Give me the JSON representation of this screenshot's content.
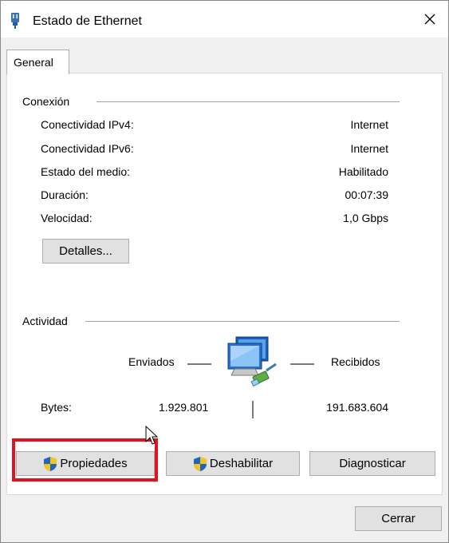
{
  "window": {
    "title": "Estado de Ethernet",
    "close_icon": "close-icon",
    "app_icon": "ethernet-plug-icon"
  },
  "tabs": [
    {
      "label": "General",
      "selected": true
    }
  ],
  "connection": {
    "section_label": "Conexión",
    "rows": [
      {
        "label": "Conectividad IPv4:",
        "value": "Internet"
      },
      {
        "label": "Conectividad IPv6:",
        "value": "Internet"
      },
      {
        "label": "Estado del medio:",
        "value": "Habilitado"
      },
      {
        "label": "Duración:",
        "value": "00:07:39"
      },
      {
        "label": "Velocidad:",
        "value": "1,0 Gbps"
      }
    ],
    "details_button": "Detalles..."
  },
  "activity": {
    "section_label": "Actividad",
    "sent_label": "Enviados",
    "received_label": "Recibidos",
    "bytes_label": "Bytes:",
    "bytes_sent": "1.929.801",
    "bytes_received": "191.683.604",
    "network_icon": "network-computers-icon"
  },
  "actions": {
    "properties": "Propiedades",
    "disable": "Deshabilitar",
    "diagnose": "Diagnosticar",
    "shield_icon": "uac-shield-icon"
  },
  "footer": {
    "close_button": "Cerrar"
  },
  "colors": {
    "highlight": "#e0141e",
    "button_bg": "#e1e1e1",
    "panel_bg": "#ffffff"
  }
}
